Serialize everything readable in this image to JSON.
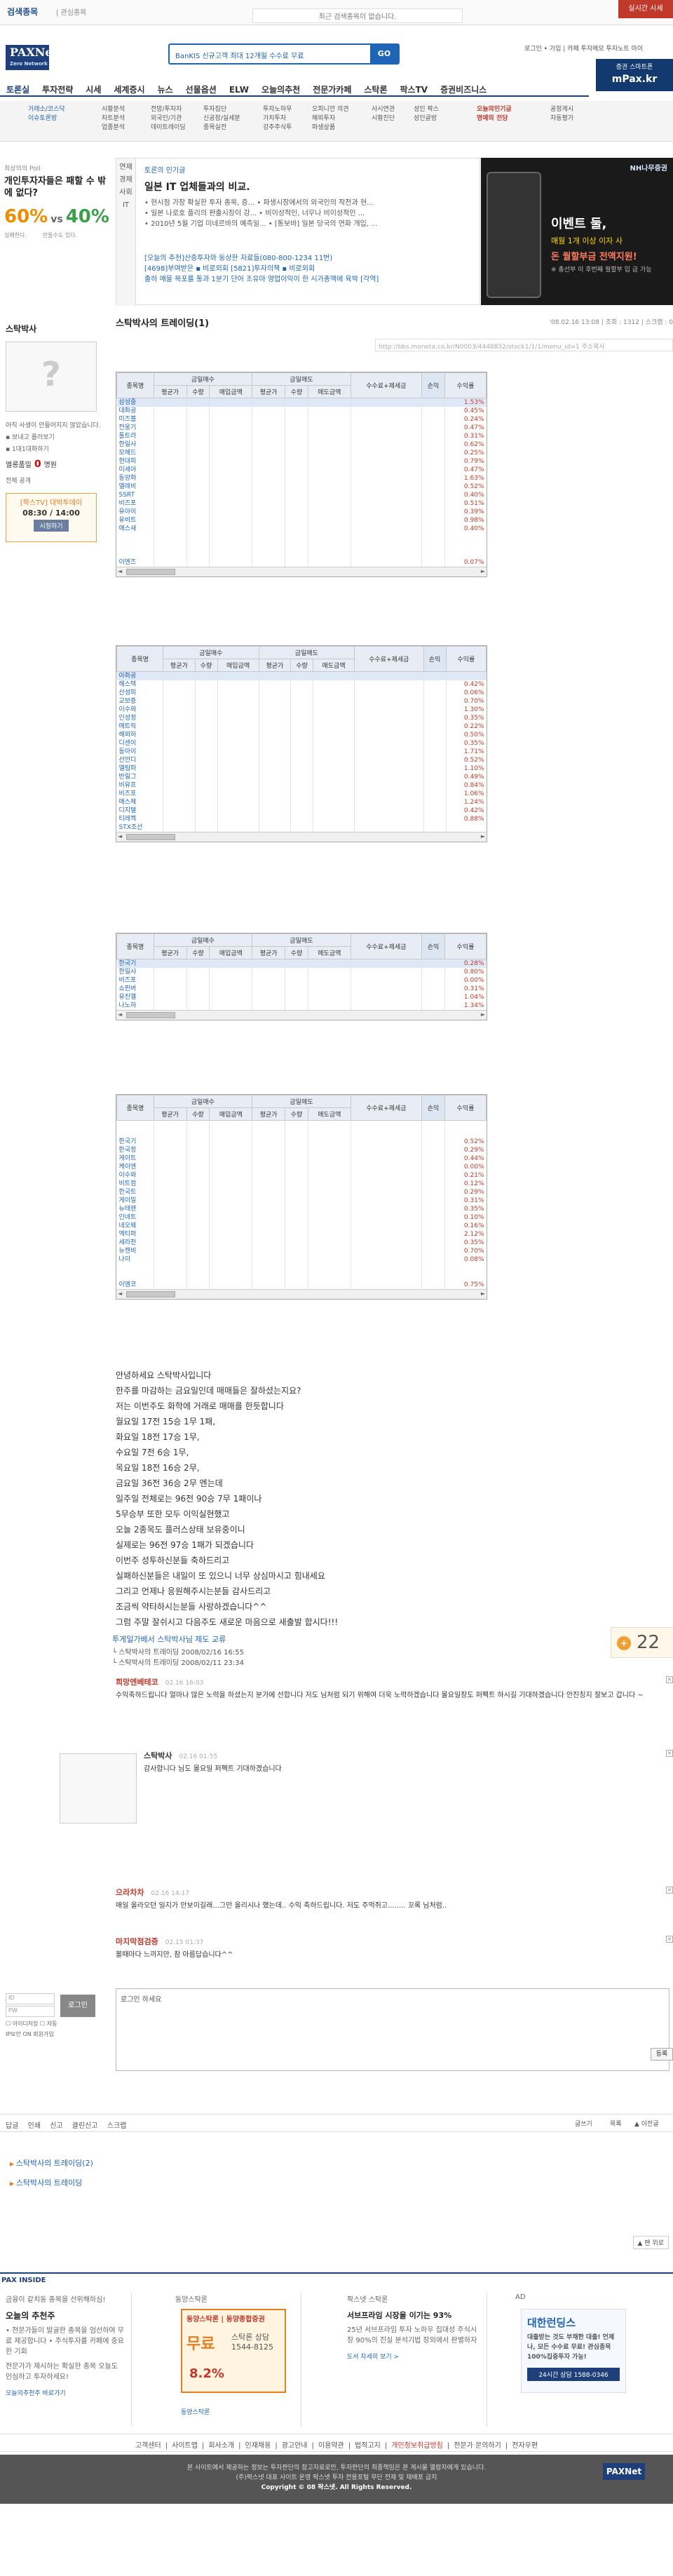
{
  "topbar": {
    "history_label": "검색종목",
    "history_sub": "| 관심종목",
    "history_text": "최근 검색종목이 없습니다.",
    "keyword_btn": "실시간 시세"
  },
  "header": {
    "logo": "PAXNet",
    "logo_sub": "Zero Network",
    "promo": "BanKIS 신규고객 최대 12개월 수수료 무료",
    "promo_go": "GO",
    "util": "로그인 • 가입 | 카페 투자메모 투자노트 마이",
    "mpax": "증권 스마트폰",
    "mpax_b": "mPax.kr",
    "nav": [
      "토론실",
      "투자전략",
      "시세",
      "세계증시",
      "뉴스",
      "선물옵션",
      "ELW",
      "오늘의추천",
      "전문가카페",
      "스탁론",
      "팍스TV",
      "증권비즈니스"
    ]
  },
  "subnav": {
    "cols": [
      [
        "거래소/코스닥",
        "이슈토론방"
      ],
      [
        "시황분석",
        "차트분석",
        "업종분석"
      ],
      [
        "전망/투자자",
        "외국인/기관",
        "데이트레이딩"
      ],
      [
        "투자집단",
        "신공장/실세분",
        "종목실전"
      ],
      [
        "투자노하우",
        "가치투자",
        "강추주식투"
      ],
      [
        "오피니언 의견",
        "해외투자",
        "파생상품"
      ],
      [
        "사시연관",
        "시황진단"
      ],
      [
        "성인 팍스",
        "성인골방"
      ],
      [
        "오늘의인기글",
        "명예의 전당"
      ],
      [
        "공정게시",
        "자동평가"
      ]
    ]
  },
  "poll": {
    "label": "최상의의 Poll",
    "question": "개인투자자들은 패할 수 밖에 없다?",
    "yes": "60%",
    "vs": "vs",
    "no": "40%",
    "foot_l": "실패한다.",
    "foot_r": "만들수도 있다."
  },
  "best": {
    "tabs": [
      "연재",
      "경제",
      "사회",
      "IT"
    ],
    "head": "토론의 인기글",
    "feature": "일본 IT 업체들과의 비교.",
    "lines": [
      "• 현시점 가장 확실한 투자 종목, 증...   • 파생시장에서의 외국인의 작전과 현...",
      "• 일본 나로호 플리의 판출시장이 강...   • 비이성적인, 너무나 비이성적인 ...",
      "• 2010년 5월 기업 미네르바의 예측일...   • [통보바] 일본 당국의 연화 개입, ..."
    ],
    "news": [
      "[오늘의 추천]산중투자와 동상한 자료들(080-800-1234 11번)",
      "[4698]부여받은 ▪ 비로외회       [5821]투자의책 ▪ 비로외회",
      "출하 매물 목포를 통과 1분기 단어 조유마  영업이익이 한 시가총액에 육박 [각역]"
    ]
  },
  "ad_right": {
    "top": "NH나무증권",
    "t1": "이벤트 둘,",
    "t2": "매월 1개 이상 이자 사",
    "t3": "돈 월할부금 전액지원!",
    "t4": "※ 총선부 이 후번째 월할부 입 금 가능"
  },
  "profile": {
    "title": "스탁박사",
    "line1": "아직 사생이 안들어지지 않았습니다.",
    "line2": "▪ 보내고 플러보기",
    "line3": "▪ 1대1대화하기",
    "fans_label": "엘롱품밀",
    "fans_n": "0",
    "fans_unit": "명원",
    "fans_sub": "전체 공개",
    "bc1": "[팍스TV] 대박투데이",
    "bc2": "08:30 / 14:00",
    "bc3": "시청하기"
  },
  "post": {
    "title": "스탁박사의 트레이딩(1)",
    "meta": "'08.02.16 13:08 | 조회 : 1312 | 스크랩 : 0",
    "url": "http://bbs.moneta.co.kr/N0003/4448832/stock1/1/1/menu_id=1 주소복사"
  },
  "grid_headers": {
    "c0": "종목명",
    "c1": "금일매수",
    "c1a": "평균가",
    "c1b": "수량",
    "c1c": "매입금액",
    "c2": "금일매도",
    "c2a": "평균가",
    "c2b": "수량",
    "c2c": "매도금액",
    "c3": "수수료+제세금",
    "c4": "손익",
    "c5": "수익률"
  },
  "grids": [
    {
      "names": [
        "삼성중",
        "대화공",
        "미즈볼",
        "전웅기",
        "톨트라",
        "한일사",
        "모헤드",
        "현대피",
        "미세아",
        "동양화",
        "엘레비",
        "SSRT",
        "비즈포",
        "유아이",
        "유비트",
        "애스새",
        "",
        "",
        "",
        "이엔즈"
      ],
      "pct": [
        "1.53%",
        "0.45%",
        "0.24%",
        "0.47%",
        "0.31%",
        "0.62%",
        "0.25%",
        "0.79%",
        "0.47%",
        "1.63%",
        "0.52%",
        "0.40%",
        "0.51%",
        "0.39%",
        "0.98%",
        "0.40%",
        "",
        "",
        "",
        "0.07%"
      ]
    },
    {
      "names": [
        "아화공",
        "해스텍",
        "산성피",
        "교보증",
        "이수와",
        "인성정",
        "메트릭",
        "해외하",
        "디센이",
        "동아이",
        "선언디",
        "엘림파",
        "반릴그",
        "비유프",
        "비즈포",
        "매스체",
        "디지텔",
        "티레켁",
        "STX조선"
      ],
      "pct": [
        "",
        "0.42%",
        "0.06%",
        "0.70%",
        "1.30%",
        "0.35%",
        "0.22%",
        "0.50%",
        "0.35%",
        "1.71%",
        "0.52%",
        "1.10%",
        "0.49%",
        "0.84%",
        "1.06%",
        "1.24%",
        "0.42%",
        "0.88%",
        ""
      ]
    },
    {
      "names": [
        "한국기",
        "한일사",
        "비즈포",
        "쇼핀버",
        "유진엘",
        "나노하"
      ],
      "pct": [
        "0.28%",
        "0.80%",
        "0.00%",
        "0.31%",
        "1.04%",
        "1.34%"
      ]
    },
    {
      "names": [
        "",
        "",
        "한국기",
        "한국정",
        "게이트",
        "케이엔",
        "이수와",
        "비트컴",
        "한국트",
        "게이밀",
        "뉴테랜",
        "인네트",
        "네오웨",
        "엑티퍼",
        "세라천",
        "뉴젠비",
        "나이",
        "",
        "",
        "이엠코"
      ],
      "pct": [
        "",
        "",
        "0.52%",
        "0.29%",
        "0.44%",
        "0.00%",
        "0.21%",
        "0.12%",
        "0.29%",
        "0.31%",
        "0.35%",
        "0.10%",
        "0.16%",
        "2.12%",
        "0.35%",
        "0.70%",
        "0.08%",
        "",
        "",
        "0.75%"
      ]
    }
  ],
  "body": [
    "안녕하세요 스탁박사입니다",
    "한주를 마감하는 금요일인데 매매들은 잘하셨는지요?",
    "저는 이번주도 화학에 거래로 매매를 한듯합니다",
    "월요일 17전 15승 1무 1패,",
    "화요일 18전 17승 1무,",
    "수요일 7전 6승 1무,",
    "목요일 18전 16승 2무,",
    "금요일 36전 36승 2무 엔는데",
    "일주일 전체로는 96전 90승 7무 1패이나",
    "5무승부 또한 모두 이익실현했고",
    "오늘 2종목도 플러스상태 보유중이니",
    "실제로는 96전 97승 1패가 되겠습니다",
    "이번주 성투하신분들 축하드리고",
    "실패하신분들은 내일이 또 있으니 너무 상심마시고 힘내세요",
    "그리고 언제나 응원해주시는분들 감사드리고",
    "조금씩 약타하시는분들 사랑하겠습니다^^",
    "그럼 주말 잘쉬시고 다음주도 새로운 마음으로 새출발 합시다!!!"
  ],
  "recommend": {
    "head": "투게일가베서 스탁박사님 제도 교류",
    "r1": "└ 스탁박사의 트레이딩     2008/02/16 16:55",
    "r2": "└ 스탁박사의 트레이딩     2008/02/11 23:34",
    "count": "22"
  },
  "comments": [
    {
      "who": "희망엔베테코",
      "when": "02.16 16:03",
      "txt": "수익축하드립니다 얼마나 많은 노력을 하셨는지 분가에 선합니다 저도 님처럼 되기 위해여 더욱 노력하겠습니다 몰요일장도 퍼펙트 하시길 기대하겠습니다 안진칭지 잘보고 갑니다 ~"
    },
    {
      "who": "스탁박사",
      "when": "02.16 01:55",
      "txt": "감사합니다 님도 몰요일 퍼펙트 기대하겠습니다"
    },
    {
      "who": "으라차차",
      "when": "02.16 14:17",
      "txt": "매일 올라오던 일지가 안보이길래...그만 올리시나 했는데.. 수익 축하드립니다. 저도 주먹쥐고........ 꼬록 님처럼.."
    },
    {
      "who": "마지막점검중",
      "when": "02.15 01:37",
      "txt": "볼때마다 느끼지만, 참 아름답습니다^^"
    }
  ],
  "login": {
    "id_ph": "ID",
    "pw_ph": "PW",
    "btn": "로그인",
    "opt1": "☐ 아이디저장   ☐ 자동",
    "opt2": "IP보안 ON  회원가입"
  },
  "comment_box": {
    "placeholder": "로그인 하세요",
    "submit": "등록"
  },
  "tools": {
    "items": [
      "답글",
      "인쇄",
      "신고",
      "클린신고",
      "스크랩"
    ],
    "r1": "글쓰기",
    "r2": "목록",
    "r3": "▲ 이전글"
  },
  "related": [
    "스탁박사의 트레이딩(2)",
    "스탁박사의 트레이딩"
  ],
  "toplink": "▲ 맨 위로",
  "paxinside": {
    "label": "PAX INSIDE",
    "c1h": "금융이 같치동 종목을 선위해하심!",
    "c1b": "오늘의 추천주",
    "c1t": "• 전문가들이 발굴한 종목을 엄선하여 무료 제공합니다 • 주식투자를 카페에 중요한 기회",
    "c1t2": "전문가가 제시하는 확실한 종목 오늘도 인심하고 투자하세요!",
    "c1l": "오늘의추천주 바로가기",
    "c2h": "동양스탁론",
    "c2ad1": "동양스탁론 | 동양종합증권",
    "c2ad2": "무료",
    "c2ad3": "스탁론 상담 1544-8125",
    "c2ad4": "8.2%",
    "c2l": "동양스탁론",
    "c3h": "팍스넷 스탁론",
    "c3b": "서브프라임 시장을 이기는 93%",
    "c3t": "25년 서브프라임 투자 노하우 집대성 주식시장 90%의 진실 분석기법 장외에서 판별하자",
    "c3l": "도서 자세히 보기 >",
    "c4h": "AD",
    "c4a": "대한런딩스",
    "c4b": "대출받는 것도 부채한 대출! 언제나, 모든 수수료 무료! 관심종목 100%집중투자 가능!",
    "c4c": "24시간 상담 1588-0346"
  },
  "footer": {
    "links": [
      "고객센터",
      "사이트맵",
      "회사소개",
      "인재채용",
      "광고안내",
      "이용약관",
      "법적고지",
      "개인정보취급방침",
      "전문가 문의하기",
      "전자우편"
    ],
    "copy1": "본 사이트에서 제공하는 정보는 투자판단의 참고자료로만, 투자판단의 최종책임은 본 게시물 열람자에게 있습니다.",
    "copy2": "(주)팍스넷 대표 사이트 운영 팍스넷 투자 전용포털 무단 전재 및 재배포 금지",
    "copy3": "Copyright © 08 팍스넷. All Rights Reserved.",
    "flogo": "PAXNet"
  }
}
